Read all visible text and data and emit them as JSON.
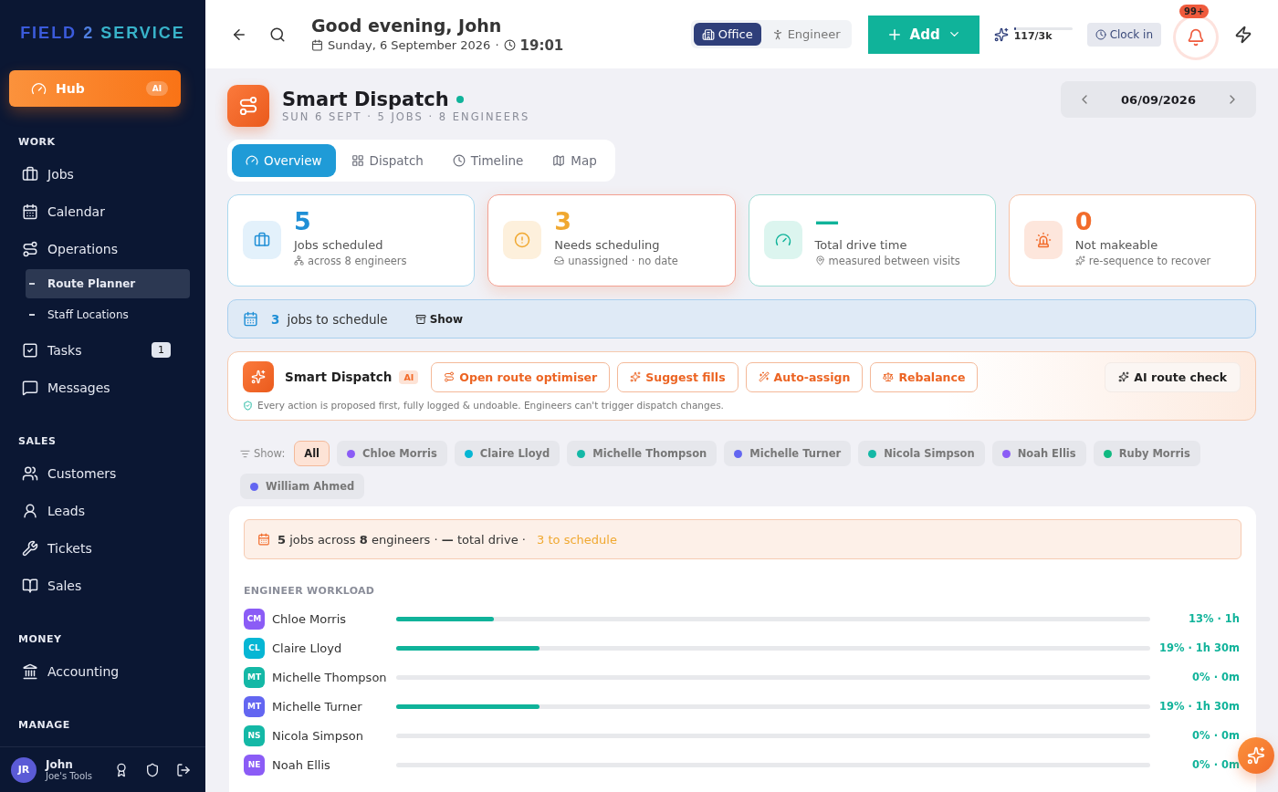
{
  "sidebar": {
    "logo": {
      "part1": "FIELD",
      "part2": "2",
      "part3": "SERVICE"
    },
    "hub": {
      "label": "Hub",
      "badge": "AI"
    },
    "sections": [
      {
        "title": "WORK",
        "items": [
          {
            "label": "Jobs",
            "selected": false
          },
          {
            "label": "Calendar",
            "selected": false
          },
          {
            "label": "Operations",
            "selected": false,
            "children": [
              {
                "label": "Route Planner",
                "selected": true
              },
              {
                "label": "Staff Locations",
                "selected": false
              }
            ]
          },
          {
            "label": "Tasks",
            "selected": false,
            "badge": "1"
          },
          {
            "label": "Messages",
            "selected": false
          }
        ]
      },
      {
        "title": "SALES",
        "items": [
          {
            "label": "Customers",
            "selected": false
          },
          {
            "label": "Leads",
            "selected": false
          },
          {
            "label": "Tickets",
            "selected": false
          },
          {
            "label": "Sales",
            "selected": false
          }
        ]
      },
      {
        "title": "MONEY",
        "items": [
          {
            "label": "Accounting",
            "selected": false
          }
        ]
      },
      {
        "title": "MANAGE"
      }
    ],
    "user": {
      "initials": "JR",
      "name": "John",
      "company": "Joe's Tools"
    }
  },
  "header": {
    "greeting": "Good evening, John",
    "date": "Sunday, 6 September 2026",
    "separator": "·",
    "time": "19:01",
    "modes": [
      {
        "label": "Office",
        "selected": true
      },
      {
        "label": "Engineer",
        "selected": false
      }
    ],
    "add_button": "Add",
    "credits": {
      "reading": "117/3k",
      "level": 0.04
    },
    "clock_in": "Clock in",
    "notifications": "99+"
  },
  "page": {
    "title": "Smart Dispatch",
    "subtitle": "SUN 6 SEPT · 5 JOBS · 8 ENGINEERS",
    "date": "06/09/2026",
    "tabs": [
      {
        "label": "Overview",
        "selected": true
      },
      {
        "label": "Dispatch",
        "selected": false
      },
      {
        "label": "Timeline",
        "selected": false
      },
      {
        "label": "Map",
        "selected": false
      }
    ],
    "stats": [
      {
        "value": "5",
        "label": "Jobs scheduled",
        "note": "across 8 engineers",
        "kind": "blue",
        "selected": false
      },
      {
        "value": "3",
        "label": "Needs scheduling",
        "note": "unassigned · no date",
        "kind": "amber",
        "selected": true
      },
      {
        "value": "—",
        "label": "Total drive time",
        "note": "measured between visits",
        "kind": "teal",
        "selected": false
      },
      {
        "value": "0",
        "label": "Not makeable",
        "note": "re-sequence to recover",
        "kind": "orange",
        "selected": false
      }
    ],
    "schedule_banner": {
      "count": "3",
      "text": "jobs to schedule",
      "button": "Show"
    },
    "smart_dispatch": {
      "title": "Smart Dispatch",
      "badge": "AI",
      "actions": [
        "Open route optimiser",
        "Suggest fills",
        "Auto-assign",
        "Rebalance"
      ],
      "check_button": "AI route check",
      "note": "Every action is proposed first, fully logged & undoable. Engineers can't trigger dispatch changes."
    },
    "filter": {
      "label": "Show:",
      "chips": [
        {
          "label": "All",
          "selected": true
        },
        {
          "label": "Chloe Morris",
          "color": "#8b5cf6",
          "selected": false
        },
        {
          "label": "Claire Lloyd",
          "color": "#06b6d4",
          "selected": false
        },
        {
          "label": "Michelle Thompson",
          "color": "#14b8a6",
          "selected": false
        },
        {
          "label": "Michelle Turner",
          "color": "#6366f1",
          "selected": false
        },
        {
          "label": "Nicola Simpson",
          "color": "#14b8a6",
          "selected": false
        },
        {
          "label": "Noah Ellis",
          "color": "#8b5cf6",
          "selected": false
        },
        {
          "label": "Ruby Morris",
          "color": "#10b981",
          "selected": false
        },
        {
          "label": "William Ahmed",
          "color": "#6366f1",
          "selected": false
        }
      ]
    },
    "summary": "**5** jobs across **8** engineers · **—** total drive · ",
    "summary_highlight": "3 to schedule",
    "workload": {
      "title": "ENGINEER WORKLOAD",
      "rows": [
        {
          "initials": "CM",
          "name": "Chloe Morris",
          "color": "#8b5cf6",
          "level": 0.13,
          "reading": "13% · 1h"
        },
        {
          "initials": "CL",
          "name": "Claire Lloyd",
          "color": "#06b6d4",
          "level": 0.19,
          "reading": "19% · 1h 30m"
        },
        {
          "initials": "MT",
          "name": "Michelle Thompson",
          "color": "#14b8a6",
          "level": 0,
          "reading": "0% · 0m"
        },
        {
          "initials": "MT",
          "name": "Michelle Turner",
          "color": "#6366f1",
          "level": 0.19,
          "reading": "19% · 1h 30m"
        },
        {
          "initials": "NS",
          "name": "Nicola Simpson",
          "color": "#14b8a6",
          "level": 0,
          "reading": "0% · 0m"
        },
        {
          "initials": "NE",
          "name": "Noah Ellis",
          "color": "#8b5cf6",
          "level": 0,
          "reading": "0% · 0m"
        }
      ]
    }
  }
}
